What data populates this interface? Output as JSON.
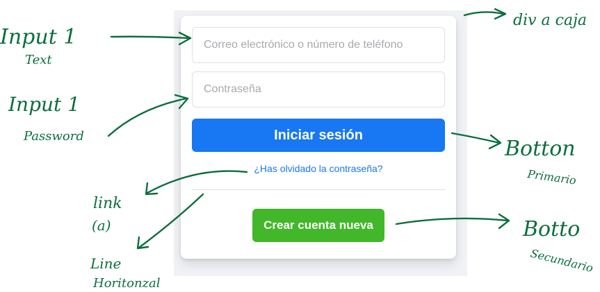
{
  "form": {
    "email_placeholder": "Correo electrónico o número de teléfono",
    "password_placeholder": "Contraseña",
    "login_label": "Iniciar sesión",
    "forgot_label": "¿Has olvidado la contraseña?",
    "create_label": "Crear cuenta nueva"
  },
  "colors": {
    "primary": "#1877f2",
    "secondary": "#42b72a",
    "backdrop": "#f0f2f5",
    "annotation_ink": "#0b6e3d"
  },
  "annotations": {
    "input_text": [
      "Input 1",
      "Text"
    ],
    "input_password": [
      "Input 1",
      "Password"
    ],
    "div_box": "div a caja",
    "button_primary": [
      "Botton",
      "Primario"
    ],
    "link": [
      "link",
      "(a)"
    ],
    "line": [
      "Line",
      "Horitonzal"
    ],
    "button_secondary": [
      "Botto",
      "Secundario"
    ]
  }
}
